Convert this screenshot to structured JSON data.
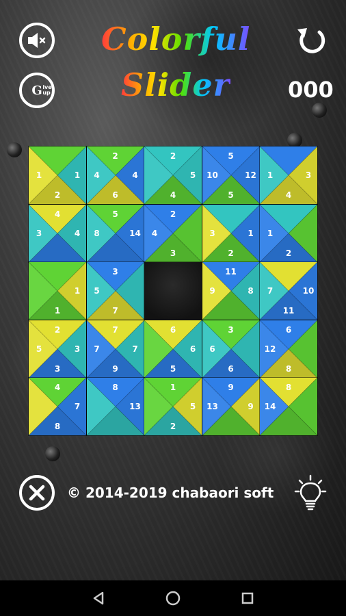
{
  "title": {
    "line1": "Colorful",
    "line2": "Slider"
  },
  "moves": "000",
  "copyright": "© 2014-2019 chabaori soft",
  "giveup": {
    "big": "G",
    "small": "ive up"
  },
  "colors": {
    "y": "#e2e032",
    "g": "#5fd335",
    "c": "#33c5c0",
    "b": "#2f7fe8"
  },
  "board": {
    "rows": 5,
    "cols": 5,
    "empty": [
      2,
      2
    ],
    "tiles": [
      [
        {
          "c": [
            "g",
            "c",
            "y",
            "y"
          ],
          "n": [
            "",
            "1",
            "2",
            "1"
          ]
        },
        {
          "c": [
            "g",
            "b",
            "y",
            "c"
          ],
          "n": [
            "2",
            "4",
            "6",
            "4"
          ]
        },
        {
          "c": [
            "c",
            "c",
            "g",
            "c"
          ],
          "n": [
            "2",
            "5",
            "4",
            ""
          ]
        },
        {
          "c": [
            "b",
            "b",
            "g",
            "b"
          ],
          "n": [
            "5",
            "12",
            "5",
            "10"
          ]
        },
        {
          "c": [
            "b",
            "y",
            "y",
            "c"
          ],
          "n": [
            "",
            "3",
            "4",
            "1"
          ]
        }
      ],
      [
        {
          "c": [
            "y",
            "c",
            "b",
            "c"
          ],
          "n": [
            "4",
            "4",
            "",
            "3"
          ]
        },
        {
          "c": [
            "g",
            "b",
            "b",
            "c"
          ],
          "n": [
            "5",
            "14",
            "",
            "8"
          ]
        },
        {
          "c": [
            "b",
            "g",
            "g",
            "b"
          ],
          "n": [
            "2",
            "",
            "3",
            "4"
          ]
        },
        {
          "c": [
            "c",
            "b",
            "g",
            "y"
          ],
          "n": [
            "",
            "1",
            "2",
            "3"
          ]
        },
        {
          "c": [
            "c",
            "g",
            "b",
            "b"
          ],
          "n": [
            "",
            "",
            "2",
            "1"
          ]
        }
      ],
      [
        {
          "c": [
            "g",
            "y",
            "g",
            "g"
          ],
          "n": [
            "",
            "1",
            "1",
            ""
          ]
        },
        {
          "c": [
            "b",
            "c",
            "y",
            "c"
          ],
          "n": [
            "3",
            "",
            "7",
            "5"
          ]
        },
        null,
        {
          "c": [
            "b",
            "c",
            "g",
            "y"
          ],
          "n": [
            "11",
            "8",
            "",
            "9"
          ]
        },
        {
          "c": [
            "y",
            "b",
            "b",
            "c"
          ],
          "n": [
            "",
            "10",
            "11",
            "7"
          ]
        }
      ],
      [
        {
          "c": [
            "y",
            "c",
            "b",
            "y"
          ],
          "n": [
            "2",
            "3",
            "3",
            "5"
          ]
        },
        {
          "c": [
            "y",
            "c",
            "b",
            "b"
          ],
          "n": [
            "7",
            "7",
            "9",
            "7"
          ]
        },
        {
          "c": [
            "y",
            "c",
            "b",
            "g"
          ],
          "n": [
            "6",
            "6",
            "5",
            ""
          ]
        },
        {
          "c": [
            "g",
            "c",
            "b",
            "c"
          ],
          "n": [
            "3",
            "",
            "6",
            "6"
          ]
        },
        {
          "c": [
            "b",
            "g",
            "y",
            "b"
          ],
          "n": [
            "6",
            "",
            "8",
            "12"
          ]
        }
      ],
      [
        {
          "c": [
            "g",
            "b",
            "b",
            "y"
          ],
          "n": [
            "4",
            "7",
            "8",
            ""
          ]
        },
        {
          "c": [
            "b",
            "b",
            "c",
            "c"
          ],
          "n": [
            "8",
            "13",
            "",
            ""
          ]
        },
        {
          "c": [
            "g",
            "y",
            "c",
            "g"
          ],
          "n": [
            "1",
            "5",
            "2",
            ""
          ]
        },
        {
          "c": [
            "b",
            "y",
            "g",
            "b"
          ],
          "n": [
            "9",
            "9",
            "",
            "13"
          ]
        },
        {
          "c": [
            "y",
            "g",
            "g",
            "b"
          ],
          "n": [
            "8",
            "",
            "",
            "14"
          ]
        }
      ]
    ]
  },
  "icons": {
    "sound": "speaker-muted-icon",
    "giveup": "give-up-icon",
    "reset": "refresh-icon",
    "close": "close-icon",
    "hint": "lightbulb-icon",
    "back": "nav-back-icon",
    "home": "nav-home-icon",
    "recents": "nav-recents-icon"
  }
}
